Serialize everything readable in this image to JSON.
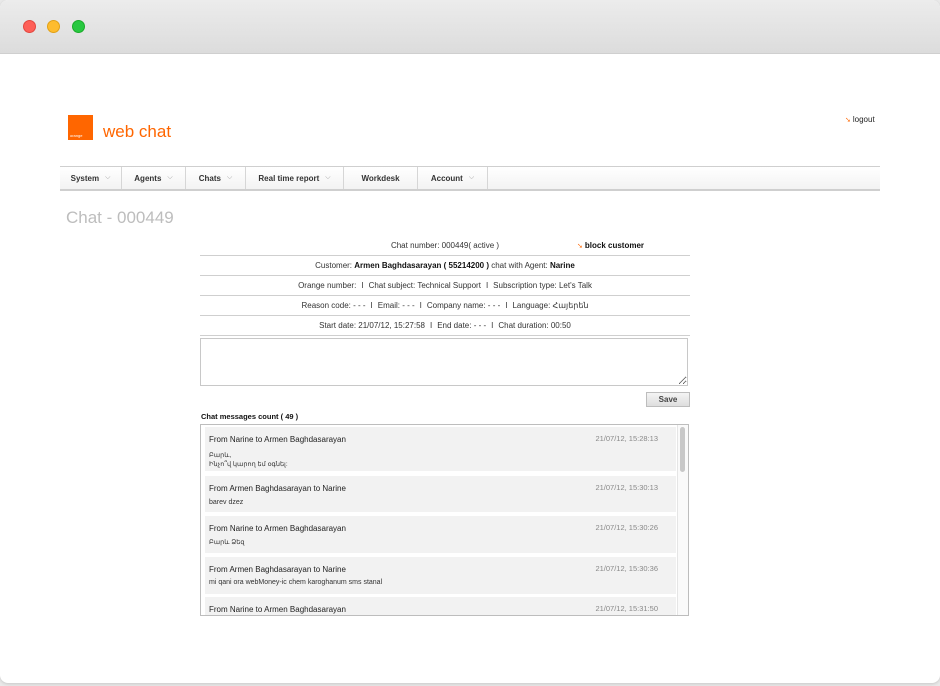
{
  "brand": {
    "logo_text": "orange",
    "name": "web chat"
  },
  "header": {
    "logout_label": "logout"
  },
  "menu": [
    {
      "label": "System",
      "chevron": true
    },
    {
      "label": "Agents",
      "chevron": true
    },
    {
      "label": "Chats",
      "chevron": true
    },
    {
      "label": "Real time report",
      "chevron": true
    },
    {
      "label": "Workdesk",
      "chevron": false
    },
    {
      "label": "Account",
      "chevron": true
    }
  ],
  "page": {
    "title": "Chat - 000449"
  },
  "chat_info": {
    "chat_number_label": "Chat number:",
    "chat_number": "000449",
    "status": "( active )",
    "block_label": "block customer",
    "customer_label": "Customer:",
    "customer": "Armen Baghdasarayan ( 55214200 )",
    "agent_label": "chat with Agent:",
    "agent": "Narine",
    "orange_number": "Orange number:",
    "subject": "Chat subject: Technical Support",
    "subscription": "Subscription type: Let's Talk",
    "reason": "Reason code: - - -",
    "email": "Email: - - -",
    "company": "Company name: - - -",
    "language": "Language: Հայերեն",
    "start": "Start date: 21/07/12, 15:27:58",
    "end": "End date: - - -",
    "duration": "Chat duration: 00:50",
    "separator": "I"
  },
  "note": {
    "value": ""
  },
  "save_label": "Save",
  "messages_count_label": "Chat messages count ( 49 )",
  "messages": [
    {
      "from": "From Narine to Armen Baghdasarayan",
      "time": "21/07/12, 15:28:13",
      "line1": "Բարև,",
      "line2": "Ինչո՞վ կարող եմ օգնել:"
    },
    {
      "from": "From Armen Baghdasarayan to Narine",
      "time": "21/07/12, 15:30:13",
      "line1": "barev dzez",
      "line2": ""
    },
    {
      "from": "From Narine to Armen Baghdasarayan",
      "time": "21/07/12, 15:30:26",
      "line1": "Բարև Ձեզ",
      "line2": ""
    },
    {
      "from": "From Armen Baghdasarayan to Narine",
      "time": "21/07/12, 15:30:36",
      "line1": "mi qani ora webMoney-ic chem karoghanum sms stanal",
      "line2": ""
    },
    {
      "from": "From Narine to Armen Baghdasarayan",
      "time": "21/07/12, 15:31:50",
      "line1": "",
      "line2": ""
    }
  ],
  "colors": {
    "accent": "#ff6600",
    "title_gray": "#bdbdbd"
  }
}
